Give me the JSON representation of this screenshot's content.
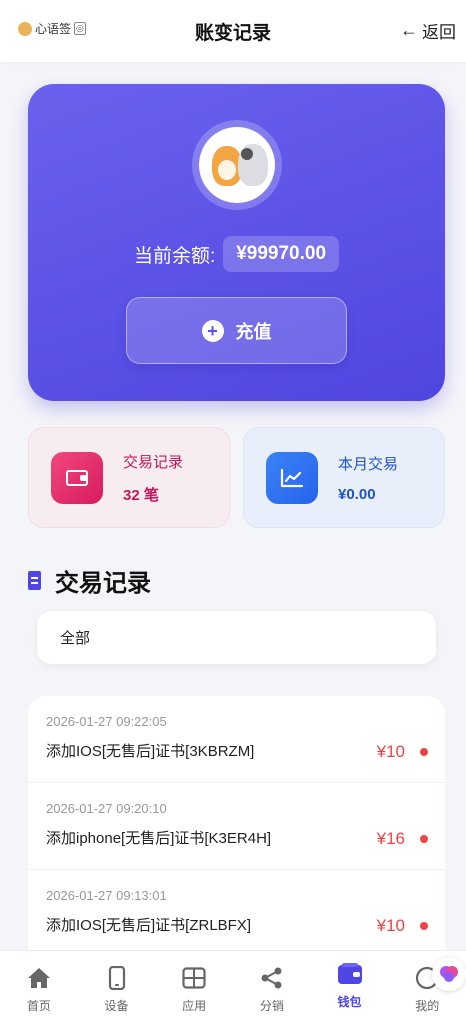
{
  "header": {
    "logo_text": "心语签",
    "logo_tag": "◎",
    "title": "账变记录",
    "back_label": "返回",
    "back_arrow": "←"
  },
  "balance": {
    "label": "当前余额:",
    "value": "¥99970.00",
    "recharge_label": "充值",
    "recharge_icon": "+"
  },
  "stats": [
    {
      "title": "交易记录",
      "value": "32 笔",
      "icon": "wallet-icon",
      "color": "#d81b60"
    },
    {
      "title": "本月交易",
      "value": "¥0.00",
      "icon": "chart-line-icon",
      "color": "#2563eb"
    }
  ],
  "section": {
    "title": "交易记录",
    "filter_value": "全部"
  },
  "transactions": [
    {
      "time": "2026-01-27 09:22:05",
      "desc": "添加IOS[无售后]证书[3KBRZM]",
      "amount": "¥10"
    },
    {
      "time": "2026-01-27 09:20:10",
      "desc": "添加iphone[无售后]证书[K3ER4H]",
      "amount": "¥16"
    },
    {
      "time": "2026-01-27 09:13:01",
      "desc": "添加IOS[无售后]证书[ZRLBFX]",
      "amount": "¥10"
    }
  ],
  "nav": [
    {
      "label": "首页",
      "icon": "home-icon"
    },
    {
      "label": "设备",
      "icon": "device-icon"
    },
    {
      "label": "应用",
      "icon": "apps-icon"
    },
    {
      "label": "分销",
      "icon": "share-icon"
    },
    {
      "label": "钱包",
      "icon": "wallet-icon",
      "active": true
    },
    {
      "label": "我的",
      "icon": "user-icon"
    }
  ],
  "colors": {
    "primary": "#4f46e5",
    "danger": "#ef4444"
  }
}
